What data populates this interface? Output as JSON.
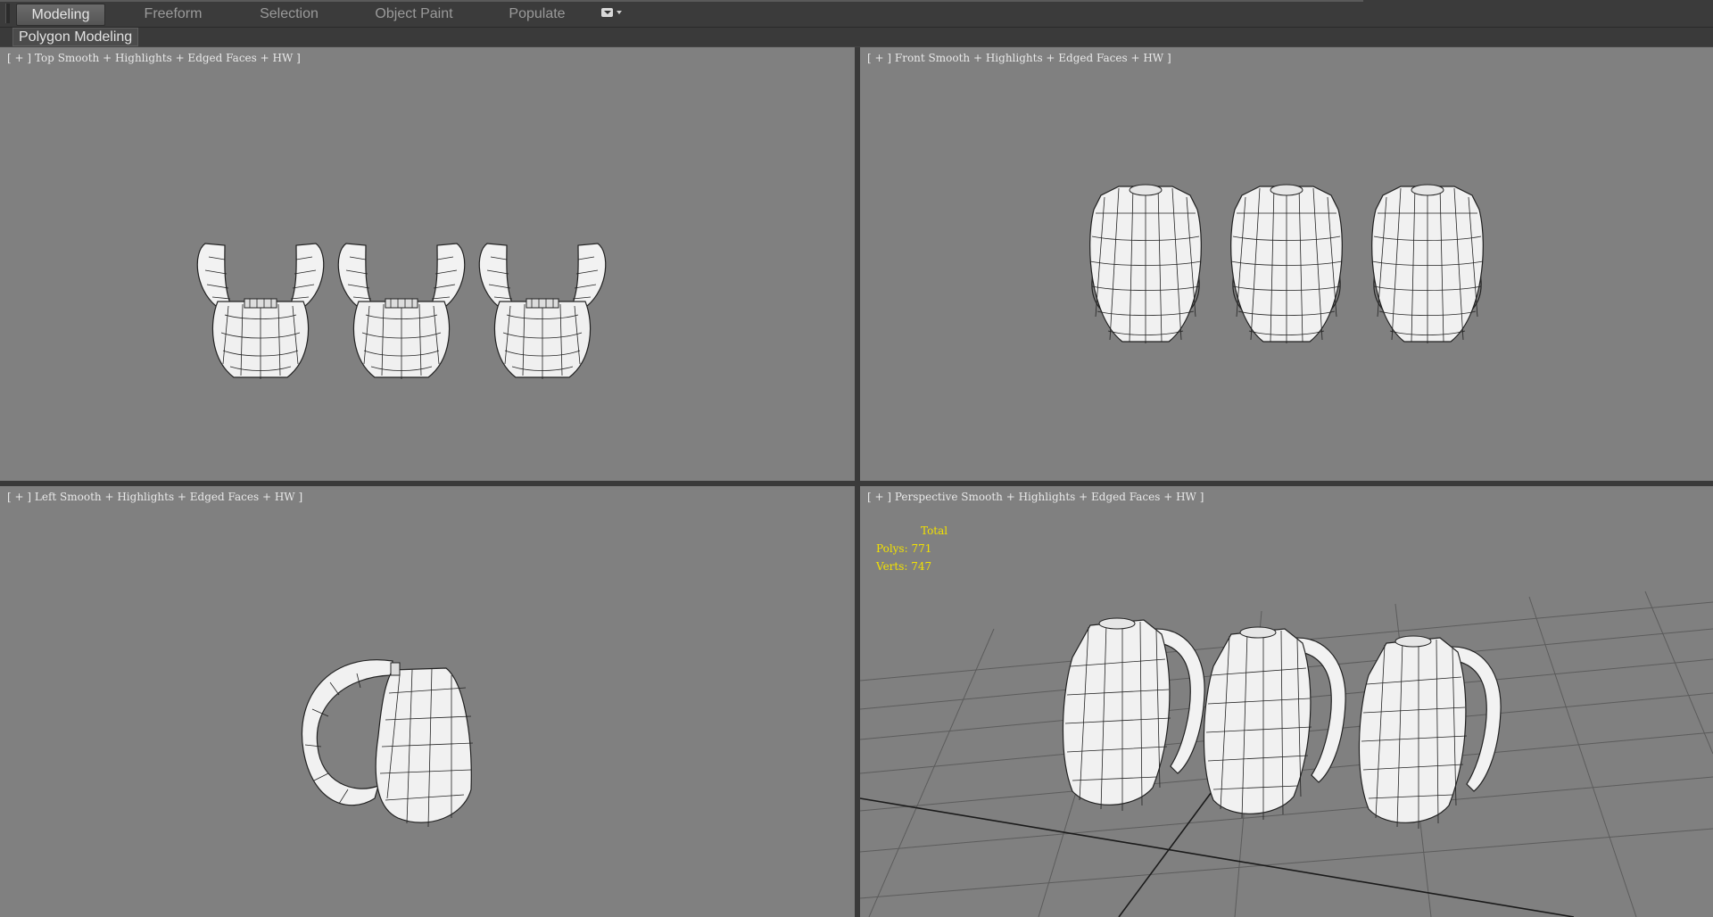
{
  "ribbon": {
    "tabs": [
      "Modeling",
      "Freeform",
      "Selection",
      "Object Paint",
      "Populate"
    ],
    "active_tab": "Modeling",
    "panel_label": "Polygon Modeling"
  },
  "viewports": {
    "top": {
      "plus": "[ + ]",
      "name": "Top",
      "mode": "Smooth + Highlights + Edged Faces + HW ]"
    },
    "front": {
      "plus": "[ + ]",
      "name": "Front",
      "mode": "Smooth + Highlights + Edged Faces + HW ]"
    },
    "left": {
      "plus": "[ + ]",
      "name": "Left",
      "mode": "Smooth + Highlights + Edged Faces + HW ]"
    },
    "perspective": {
      "plus": "[ + ]",
      "name": "Perspective",
      "mode": "Smooth + Highlights + Edged Faces + HW ]"
    }
  },
  "stats": {
    "title": "Total",
    "polys": "Polys: 771",
    "verts": "Verts: 747"
  },
  "colors": {
    "viewport_bg": "#808080",
    "stats_text": "#f2e100",
    "ui_dark": "#3a3a3a"
  }
}
